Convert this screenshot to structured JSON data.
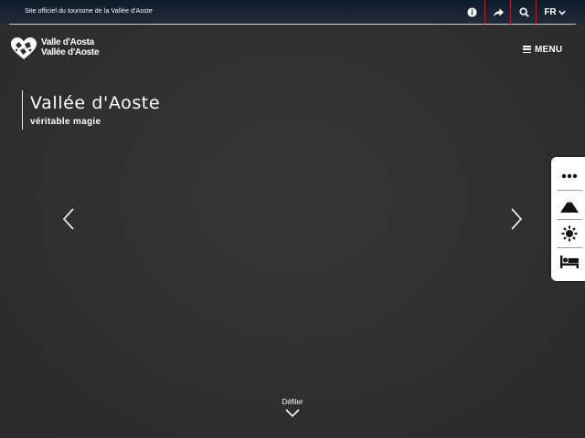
{
  "top_bar": {
    "site_tagline": "Site officiel du tourisme de la Vallée d'Aoste",
    "language": "FR",
    "separator_color": "#b21f2d"
  },
  "logo": {
    "line1": "Valle d'Aosta",
    "line2": "Vallée d'Aoste"
  },
  "header": {
    "menu_label": "MENU"
  },
  "hero": {
    "title": "Vallée d'Aoste",
    "subtitle": "véritable magie"
  },
  "side_panel": {
    "items": [
      "more-icon",
      "mountain-icon",
      "sun-icon",
      "bed-icon"
    ]
  },
  "scroll": {
    "label": "Défiler"
  }
}
